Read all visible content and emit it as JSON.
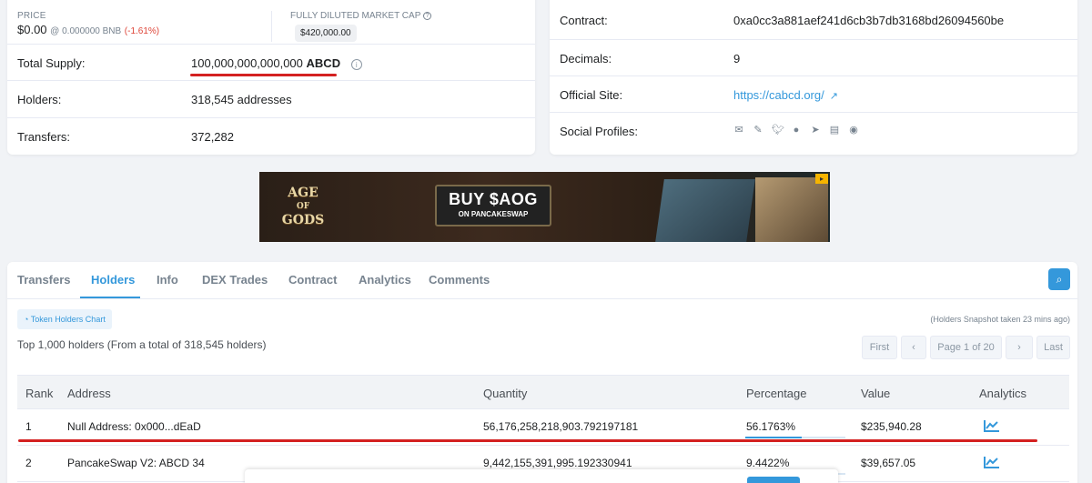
{
  "overview": {
    "price_label": "PRICE",
    "price_value": "$0.00",
    "price_bnb": "@ 0.000000 BNB",
    "price_change": "(-1.61%)",
    "fdmc_label": "FULLY DILUTED MARKET CAP",
    "fdmc_value": "$420,000.00",
    "total_supply_label": "Total Supply:",
    "total_supply_value": "100,000,000,000,000",
    "total_supply_symbol": "ABCD",
    "holders_label": "Holders:",
    "holders_value": "318,545 addresses",
    "transfers_label": "Transfers:",
    "transfers_value": "372,282"
  },
  "profile": {
    "contract_label": "Contract:",
    "contract_value": "0xa0cc3a881aef241d6cb3b7db3168bd26094560be",
    "decimals_label": "Decimals:",
    "decimals_value": "9",
    "site_label": "Official Site:",
    "site_value": "https://cabcd.org/",
    "social_label": "Social Profiles:",
    "social_icons": [
      "email-icon",
      "pencil-icon",
      "twitter-icon",
      "github-icon",
      "telegram-icon",
      "document-icon",
      "coinmarketcap-icon"
    ]
  },
  "banner": {
    "logo_line1": "AGE",
    "logo_line2": "OF",
    "logo_line3": "GODS",
    "cta_big": "BUY $AOG",
    "cta_small": "ON PANCAKESWAP"
  },
  "tabs": [
    {
      "label": "Transfers",
      "active": false
    },
    {
      "label": "Holders",
      "active": true
    },
    {
      "label": "Info",
      "active": false
    },
    {
      "label": "DEX Trades",
      "active": false
    },
    {
      "label": "Contract",
      "active": false
    },
    {
      "label": "Analytics",
      "active": false
    },
    {
      "label": "Comments",
      "active": false
    }
  ],
  "holders": {
    "chart_button": "Token Holders Chart",
    "snapshot": "(Holders Snapshot taken 23 mins ago)",
    "summary": "Top 1,000 holders (From a total of 318,545 holders)",
    "pager": {
      "first": "First",
      "prev": "‹",
      "page": "Page 1 of 20",
      "next": "›",
      "last": "Last"
    },
    "columns": [
      "Rank",
      "Address",
      "Quantity",
      "Percentage",
      "Value",
      "Analytics"
    ],
    "rows": [
      {
        "rank": "1",
        "address": "Null Address: 0x000...dEaD",
        "quantity": "56,176,258,218,903.792197181",
        "percentage": "56.1763%",
        "pct": 0.561763,
        "value": "$235,940.28"
      },
      {
        "rank": "2",
        "address": "PancakeSwap V2: ABCD 34",
        "quantity": "9,442,155,391,995.192330941",
        "percentage": "9.4422%",
        "pct": 0.094422,
        "value": "$39,657.05"
      }
    ]
  },
  "colors": {
    "accent": "#3498db",
    "negative": "#de4437",
    "annotation": "#d42121"
  }
}
